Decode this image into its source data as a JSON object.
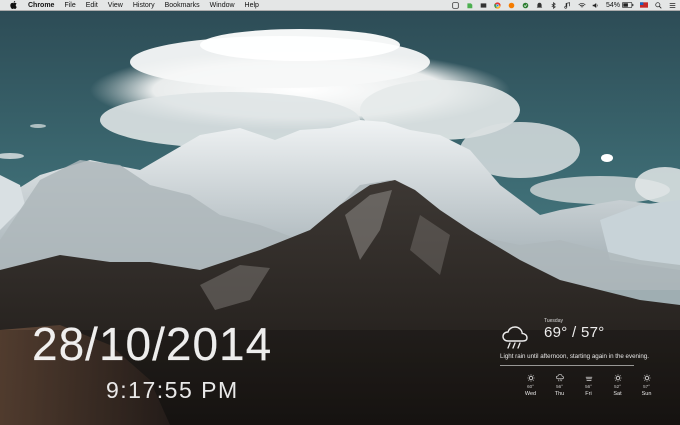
{
  "menubar": {
    "app_name": "Chrome",
    "menus": [
      "File",
      "Edit",
      "View",
      "History",
      "Bookmarks",
      "Window",
      "Help"
    ],
    "battery": "54%",
    "status_icons": [
      "chrome-extension-icon",
      "evernote-icon",
      "screen-icon",
      "chrome-icon",
      "spark-icon",
      "dropbox-icon",
      "notification-icon",
      "bluetooth-icon",
      "music-icon",
      "wifi-icon",
      "volume-icon",
      "battery-icon",
      "flag-icon",
      "search-icon",
      "list-icon"
    ]
  },
  "clock": {
    "date": "28/10/2014",
    "time": "9:17:55 PM"
  },
  "weather": {
    "current_day": "Tuesday",
    "temperature": "69° / 57°",
    "description": "Light rain until afternoon, starting again in the evening.",
    "icon": "rain-cloud-icon",
    "forecast": [
      {
        "day": "Wed",
        "temp": "60°",
        "icon": "sun-icon"
      },
      {
        "day": "Thu",
        "temp": "56°",
        "icon": "rain-icon"
      },
      {
        "day": "Fri",
        "temp": "56°",
        "icon": "cloud-icon"
      },
      {
        "day": "Sat",
        "temp": "52°",
        "icon": "sun-icon"
      },
      {
        "day": "Sun",
        "temp": "57°",
        "icon": "sun-icon"
      }
    ]
  }
}
